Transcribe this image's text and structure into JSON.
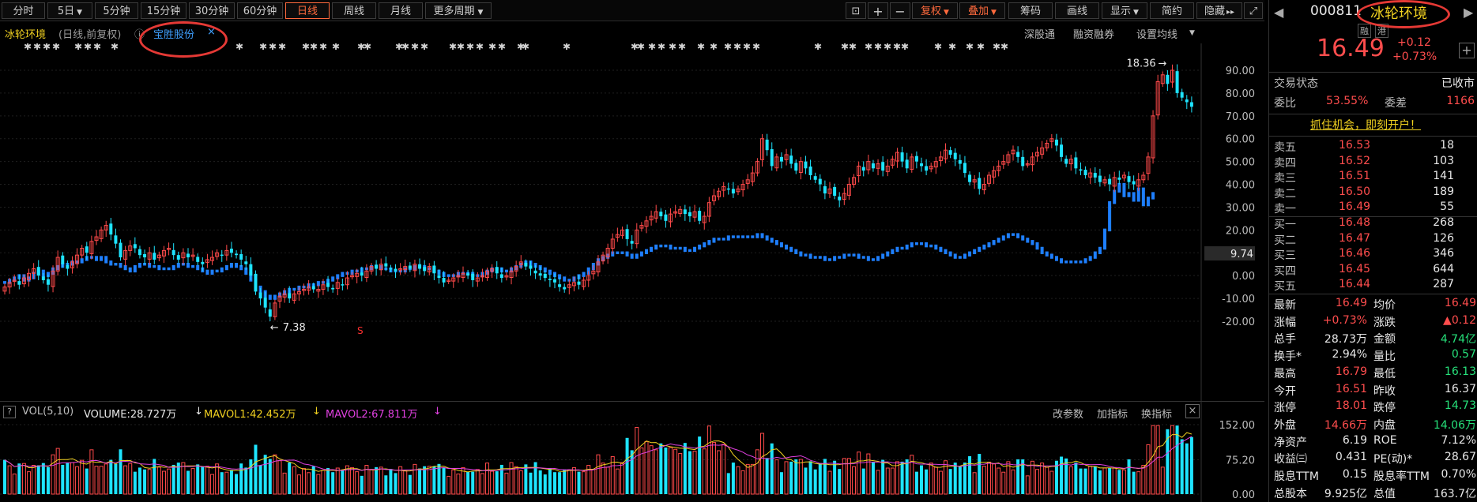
{
  "toolbar": {
    "periods": [
      "分时",
      "5日",
      "5分钟",
      "15分钟",
      "30分钟",
      "60分钟",
      "日线",
      "周线",
      "月线",
      "更多周期"
    ],
    "active_period": "日线",
    "right_buttons": [
      "复权",
      "叠加",
      "筹码",
      "画线",
      "显示",
      "简约",
      "隐藏"
    ]
  },
  "subbar": {
    "stock_name": "冰轮环境",
    "mode": "(日线,前复权)",
    "overlay_tab": "宝胜股份",
    "links": [
      "深股通",
      "融资融券",
      "设置均线"
    ]
  },
  "chart_data": {
    "type": "candlestick-overlay",
    "y_axis_ticks": [
      "90.00",
      "80.00",
      "70.00",
      "60.00",
      "50.00",
      "40.00",
      "30.00",
      "20.00",
      "10.00",
      "0.00",
      "-10.00",
      "-20.00"
    ],
    "current_marker": "9.74",
    "annotations": {
      "high": "18.36",
      "low": "7.38"
    },
    "series": [
      {
        "values_pct": [
          -5,
          -3,
          -2,
          -4,
          -1,
          1,
          3,
          0,
          -2,
          -4,
          2,
          8,
          5,
          3,
          6,
          9,
          12,
          10,
          15,
          17,
          20,
          22,
          18,
          14,
          8,
          11,
          13,
          12,
          9,
          8,
          10,
          7,
          9,
          11,
          12,
          9,
          7,
          10,
          8,
          9,
          6,
          5,
          7,
          8,
          10,
          9,
          11,
          10,
          9,
          7,
          5,
          0,
          -7,
          -10,
          -14,
          -18,
          -12,
          -9,
          -8,
          -10,
          -8,
          -7,
          -6,
          -5,
          -6,
          -6,
          -4,
          -5,
          -6,
          -3,
          -4,
          -1,
          0,
          1,
          0,
          2,
          4,
          3,
          5,
          4,
          3,
          2,
          3,
          4,
          3,
          5,
          3,
          2,
          4,
          1,
          -1,
          -3,
          -2,
          -1,
          0,
          1,
          0,
          -2,
          -1,
          0,
          2,
          3,
          1,
          -1,
          0,
          2,
          4,
          6,
          4,
          3,
          1,
          0,
          -1,
          -2,
          -3,
          -5,
          -6,
          -4,
          -3,
          -4,
          -2,
          0,
          2,
          6,
          9,
          12,
          16,
          18,
          20,
          16,
          14,
          20,
          22,
          24,
          26,
          28,
          26,
          24,
          27,
          28,
          29,
          27,
          26,
          28,
          24,
          26,
          32,
          35,
          37,
          39,
          38,
          36,
          38,
          40,
          42,
          45,
          50,
          60,
          55,
          48,
          52,
          50,
          53,
          49,
          46,
          50,
          47,
          44,
          42,
          40,
          36,
          38,
          35,
          33,
          36,
          40,
          43,
          48,
          46,
          50,
          47,
          49,
          46,
          48,
          51,
          54,
          50,
          47,
          52,
          50,
          48,
          46,
          48,
          50,
          52,
          55,
          53,
          51,
          49,
          45,
          41,
          42,
          38,
          40,
          44,
          46,
          48,
          50,
          53,
          55,
          52,
          48,
          49,
          52,
          54,
          56,
          58,
          60,
          57,
          52,
          49,
          51,
          47,
          46,
          44,
          45,
          43,
          41,
          42,
          40,
          43,
          42,
          44,
          41,
          40,
          42,
          44,
          52,
          70,
          85,
          88,
          84,
          90,
          80,
          78,
          76,
          74
        ]
      },
      {
        "values_pct": [
          -3,
          -2,
          -1,
          0,
          -2,
          -1,
          1,
          2,
          0,
          1,
          3,
          4,
          5,
          5,
          6,
          6,
          7,
          8,
          8,
          7,
          8,
          6,
          5,
          5,
          4,
          3,
          2,
          4,
          5,
          5,
          4,
          4,
          3,
          3,
          3,
          4,
          5,
          5,
          4,
          4,
          3,
          2,
          1,
          2,
          2,
          3,
          4,
          5,
          4,
          3,
          1,
          -2,
          -5,
          -7,
          -9,
          -10,
          -9,
          -8,
          -7,
          -6,
          -6,
          -5,
          -5,
          -4,
          -4,
          -3,
          -3,
          -2,
          -1,
          0,
          1,
          1,
          2,
          2,
          3,
          3,
          4,
          4,
          3,
          3,
          2,
          2,
          2,
          3,
          3,
          4,
          4,
          3,
          3,
          2,
          1,
          0,
          0,
          0,
          1,
          1,
          1,
          0,
          0,
          1,
          2,
          3,
          3,
          2,
          2,
          3,
          4,
          5,
          6,
          5,
          4,
          3,
          2,
          1,
          0,
          -1,
          -2,
          -2,
          -1,
          0,
          1,
          3,
          5,
          7,
          8,
          9,
          10,
          10,
          10,
          9,
          8,
          9,
          10,
          11,
          12,
          13,
          13,
          13,
          12,
          12,
          12,
          11,
          11,
          12,
          13,
          14,
          15,
          16,
          16,
          16,
          17,
          17,
          17,
          17,
          17,
          17,
          18,
          17,
          16,
          15,
          14,
          13,
          12,
          11,
          10,
          9,
          9,
          8,
          8,
          8,
          7,
          7,
          8,
          8,
          9,
          9,
          9,
          8,
          8,
          7,
          7,
          8,
          9,
          10,
          11,
          12,
          12,
          13,
          14,
          14,
          14,
          13,
          13,
          12,
          11,
          10,
          9,
          8,
          8,
          9,
          10,
          11,
          12,
          13,
          14,
          15,
          16,
          17,
          18,
          18,
          17,
          16,
          15,
          14,
          12,
          10,
          9,
          8,
          7,
          6,
          6,
          6,
          6,
          6,
          7,
          8,
          10,
          12,
          20,
          32,
          37,
          40,
          35,
          36,
          33,
          38,
          31,
          34,
          36
        ]
      }
    ]
  },
  "volume": {
    "help": "?",
    "label": "VOL(5,10)",
    "volume": "VOLUME:28.727万",
    "mavol1": "MAVOL1:42.452万",
    "mavol2": "MAVOL2:67.811万",
    "links": [
      "改参数",
      "加指标",
      "换指标"
    ],
    "ticks": [
      "152.00",
      "75.20",
      "0.00"
    ]
  },
  "colors": {
    "up": "#ff4a4a",
    "down": "#1ee4ff",
    "blue": "#1e7fff",
    "mavol1": "#f0d020",
    "mavol2": "#e040e0",
    "accent": "#ff6a3d"
  },
  "panel": {
    "code": "000811",
    "name": "冰轮环境",
    "badges": [
      "融",
      "港"
    ],
    "price": "16.49",
    "change": "+0.12",
    "change_pct": "+0.73%",
    "trade_status_label": "交易状态",
    "trade_status": "已收市",
    "weibi_label": "委比",
    "weibi": "53.55%",
    "weicha_label": "委差",
    "weicha": "1166",
    "promo": "抓住机会，即刻开户！",
    "asks": [
      {
        "label": "卖五",
        "price": "16.53",
        "vol": "18"
      },
      {
        "label": "卖四",
        "price": "16.52",
        "vol": "103"
      },
      {
        "label": "卖三",
        "price": "16.51",
        "vol": "141"
      },
      {
        "label": "卖二",
        "price": "16.50",
        "vol": "189"
      },
      {
        "label": "卖一",
        "price": "16.49",
        "vol": "55"
      }
    ],
    "bids": [
      {
        "label": "买一",
        "price": "16.48",
        "vol": "268"
      },
      {
        "label": "买二",
        "price": "16.47",
        "vol": "126"
      },
      {
        "label": "买三",
        "price": "16.46",
        "vol": "346"
      },
      {
        "label": "买四",
        "price": "16.45",
        "vol": "644"
      },
      {
        "label": "买五",
        "price": "16.44",
        "vol": "287"
      }
    ],
    "stats": [
      {
        "l1": "最新",
        "v1": "16.49",
        "c1": "red",
        "l2": "均价",
        "v2": "16.49",
        "c2": "red"
      },
      {
        "l1": "涨幅",
        "v1": "+0.73%",
        "c1": "red",
        "l2": "涨跌",
        "v2": "▲0.12",
        "c2": "red"
      },
      {
        "l1": "总手",
        "v1": "28.73万",
        "c1": "white",
        "l2": "金额",
        "v2": "4.74亿",
        "c2": "green"
      },
      {
        "l1": "换手*",
        "v1": "2.94%",
        "c1": "white",
        "l2": "量比",
        "v2": "0.57",
        "c2": "green"
      },
      {
        "l1": "最高",
        "v1": "16.79",
        "c1": "red",
        "l2": "最低",
        "v2": "16.13",
        "c2": "green"
      },
      {
        "l1": "今开",
        "v1": "16.51",
        "c1": "red",
        "l2": "昨收",
        "v2": "16.37",
        "c2": "white"
      },
      {
        "l1": "涨停",
        "v1": "18.01",
        "c1": "red",
        "l2": "跌停",
        "v2": "14.73",
        "c2": "green"
      },
      {
        "l1": "外盘",
        "v1": "14.66万",
        "c1": "red",
        "l2": "内盘",
        "v2": "14.06万",
        "c2": "green"
      },
      {
        "l1": "净资产",
        "v1": "6.19",
        "c1": "white",
        "l2": "ROE",
        "v2": "7.12%",
        "c2": "white"
      },
      {
        "l1": "收益㈢",
        "v1": "0.431",
        "c1": "white",
        "l2": "PE(动)*",
        "v2": "28.67",
        "c2": "white"
      },
      {
        "l1": "股息TTM",
        "v1": "0.15",
        "c1": "white",
        "l2": "股息率TTM",
        "v2": "0.70%",
        "c2": "white"
      },
      {
        "l1": "总股本",
        "v1": "9.925亿",
        "c1": "white",
        "l2": "总值",
        "v2": "163.7亿",
        "c2": "white"
      }
    ]
  }
}
